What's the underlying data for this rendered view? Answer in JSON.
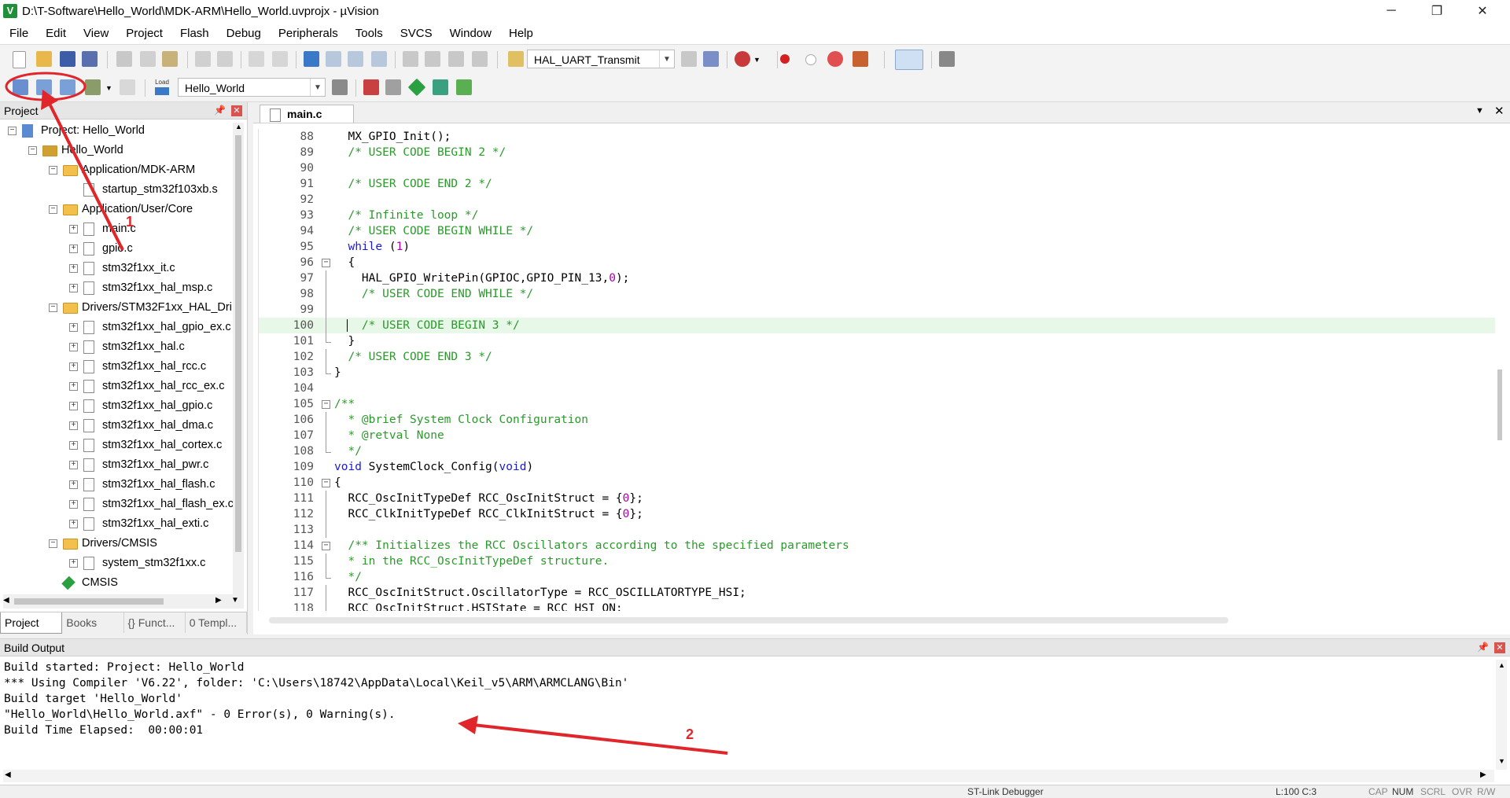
{
  "window": {
    "title": "D:\\T-Software\\Hello_World\\MDK-ARM\\Hello_World.uvprojx - µVision",
    "app_icon_letter": "V"
  },
  "menu": [
    "File",
    "Edit",
    "View",
    "Project",
    "Flash",
    "Debug",
    "Peripherals",
    "Tools",
    "SVCS",
    "Window",
    "Help"
  ],
  "toolbar1": {
    "function_combo": "HAL_UART_Transmit"
  },
  "toolbar2": {
    "load_label": "Load",
    "target_combo": "Hello_World"
  },
  "project_panel": {
    "title": "Project",
    "tree": [
      {
        "label": "Project: Hello_World",
        "level": 0,
        "kind": "root",
        "exp": "−"
      },
      {
        "label": "Hello_World",
        "level": 1,
        "kind": "target",
        "exp": "−"
      },
      {
        "label": "Application/MDK-ARM",
        "level": 2,
        "kind": "folder",
        "exp": "−"
      },
      {
        "label": "startup_stm32f103xb.s",
        "level": 3,
        "kind": "file",
        "exp": ""
      },
      {
        "label": "Application/User/Core",
        "level": 2,
        "kind": "folder",
        "exp": "−"
      },
      {
        "label": "main.c",
        "level": 3,
        "kind": "file",
        "exp": "+"
      },
      {
        "label": "gpio.c",
        "level": 3,
        "kind": "file",
        "exp": "+"
      },
      {
        "label": "stm32f1xx_it.c",
        "level": 3,
        "kind": "file",
        "exp": "+"
      },
      {
        "label": "stm32f1xx_hal_msp.c",
        "level": 3,
        "kind": "file",
        "exp": "+"
      },
      {
        "label": "Drivers/STM32F1xx_HAL_Dri",
        "level": 2,
        "kind": "folder",
        "exp": "−"
      },
      {
        "label": "stm32f1xx_hal_gpio_ex.c",
        "level": 3,
        "kind": "file",
        "exp": "+"
      },
      {
        "label": "stm32f1xx_hal.c",
        "level": 3,
        "kind": "file",
        "exp": "+"
      },
      {
        "label": "stm32f1xx_hal_rcc.c",
        "level": 3,
        "kind": "file",
        "exp": "+"
      },
      {
        "label": "stm32f1xx_hal_rcc_ex.c",
        "level": 3,
        "kind": "file",
        "exp": "+"
      },
      {
        "label": "stm32f1xx_hal_gpio.c",
        "level": 3,
        "kind": "file",
        "exp": "+"
      },
      {
        "label": "stm32f1xx_hal_dma.c",
        "level": 3,
        "kind": "file",
        "exp": "+"
      },
      {
        "label": "stm32f1xx_hal_cortex.c",
        "level": 3,
        "kind": "file",
        "exp": "+"
      },
      {
        "label": "stm32f1xx_hal_pwr.c",
        "level": 3,
        "kind": "file",
        "exp": "+"
      },
      {
        "label": "stm32f1xx_hal_flash.c",
        "level": 3,
        "kind": "file",
        "exp": "+"
      },
      {
        "label": "stm32f1xx_hal_flash_ex.c",
        "level": 3,
        "kind": "file",
        "exp": "+"
      },
      {
        "label": "stm32f1xx_hal_exti.c",
        "level": 3,
        "kind": "file",
        "exp": "+"
      },
      {
        "label": "Drivers/CMSIS",
        "level": 2,
        "kind": "folder",
        "exp": "−"
      },
      {
        "label": "system_stm32f1xx.c",
        "level": 3,
        "kind": "file",
        "exp": "+"
      },
      {
        "label": "CMSIS",
        "level": 2,
        "kind": "component",
        "exp": ""
      }
    ],
    "bottom_tabs": [
      "Project",
      "Books",
      "{} Funct...",
      "0 Templ..."
    ]
  },
  "editor": {
    "tab": "main.c",
    "lines": [
      {
        "n": "88",
        "f": "",
        "segs": [
          [
            "",
            "  MX_GPIO_Init();"
          ]
        ]
      },
      {
        "n": "89",
        "f": "",
        "segs": [
          [
            "cm",
            "  /* USER CODE BEGIN 2 */"
          ]
        ]
      },
      {
        "n": "90",
        "f": "",
        "segs": [
          [
            "",
            ""
          ]
        ]
      },
      {
        "n": "91",
        "f": "",
        "segs": [
          [
            "cm",
            "  /* USER CODE END 2 */"
          ]
        ]
      },
      {
        "n": "92",
        "f": "",
        "segs": [
          [
            "",
            ""
          ]
        ]
      },
      {
        "n": "93",
        "f": "",
        "segs": [
          [
            "cm",
            "  /* Infinite loop */"
          ]
        ]
      },
      {
        "n": "94",
        "f": "",
        "segs": [
          [
            "cm",
            "  /* USER CODE BEGIN WHILE */"
          ]
        ]
      },
      {
        "n": "95",
        "f": "",
        "segs": [
          [
            "kw",
            "  while"
          ],
          [
            "",
            " ("
          ],
          [
            "nu",
            "1"
          ],
          [
            "",
            ")"
          ]
        ]
      },
      {
        "n": "96",
        "f": "box",
        "segs": [
          [
            "",
            "  {"
          ]
        ]
      },
      {
        "n": "97",
        "f": "vl",
        "segs": [
          [
            "",
            "    HAL_GPIO_WritePin(GPIOC,GPIO_PIN_13,"
          ],
          [
            "nu",
            "0"
          ],
          [
            "",
            ");"
          ]
        ]
      },
      {
        "n": "98",
        "f": "vl",
        "segs": [
          [
            "cm",
            "    /* USER CODE END WHILE */"
          ]
        ]
      },
      {
        "n": "99",
        "f": "vl",
        "segs": [
          [
            "",
            ""
          ]
        ]
      },
      {
        "n": "100",
        "f": "vl",
        "cur": true,
        "segs": [
          [
            "cm",
            "    /* USER CODE BEGIN 3 */"
          ]
        ]
      },
      {
        "n": "101",
        "f": "end",
        "segs": [
          [
            "",
            "  }"
          ]
        ]
      },
      {
        "n": "102",
        "f": "vl",
        "segs": [
          [
            "cm",
            "  /* USER CODE END 3 */"
          ]
        ]
      },
      {
        "n": "103",
        "f": "end",
        "segs": [
          [
            "",
            "}"
          ]
        ]
      },
      {
        "n": "104",
        "f": "",
        "segs": [
          [
            "",
            ""
          ]
        ]
      },
      {
        "n": "105",
        "f": "box",
        "segs": [
          [
            "cm",
            "/**"
          ]
        ]
      },
      {
        "n": "106",
        "f": "vl",
        "segs": [
          [
            "cm",
            "  * @brief System Clock Configuration"
          ]
        ]
      },
      {
        "n": "107",
        "f": "vl",
        "segs": [
          [
            "cm",
            "  * @retval None"
          ]
        ]
      },
      {
        "n": "108",
        "f": "end",
        "segs": [
          [
            "cm",
            "  */"
          ]
        ]
      },
      {
        "n": "109",
        "f": "",
        "segs": [
          [
            "kw",
            "void"
          ],
          [
            "",
            " SystemClock_Config("
          ],
          [
            "kw",
            "void"
          ],
          [
            "",
            ")"
          ]
        ]
      },
      {
        "n": "110",
        "f": "box",
        "segs": [
          [
            "",
            "{"
          ]
        ]
      },
      {
        "n": "111",
        "f": "vl",
        "segs": [
          [
            "",
            "  RCC_OscInitTypeDef RCC_OscInitStruct = {"
          ],
          [
            "nu",
            "0"
          ],
          [
            "",
            "};"
          ]
        ]
      },
      {
        "n": "112",
        "f": "vl",
        "segs": [
          [
            "",
            "  RCC_ClkInitTypeDef RCC_ClkInitStruct = {"
          ],
          [
            "nu",
            "0"
          ],
          [
            "",
            "};"
          ]
        ]
      },
      {
        "n": "113",
        "f": "vl",
        "segs": [
          [
            "",
            ""
          ]
        ]
      },
      {
        "n": "114",
        "f": "box",
        "segs": [
          [
            "cm",
            "  /** Initializes the RCC Oscillators according to the specified parameters"
          ]
        ]
      },
      {
        "n": "115",
        "f": "vl",
        "segs": [
          [
            "cm",
            "  * in the RCC_OscInitTypeDef structure."
          ]
        ]
      },
      {
        "n": "116",
        "f": "end",
        "segs": [
          [
            "cm",
            "  */"
          ]
        ]
      },
      {
        "n": "117",
        "f": "vl",
        "segs": [
          [
            "",
            "  RCC_OscInitStruct.OscillatorType = RCC_OSCILLATORTYPE_HSI;"
          ]
        ]
      },
      {
        "n": "118",
        "f": "vl",
        "segs": [
          [
            "",
            "  RCC_OscInitStruct.HSIState = RCC_HSI_ON;"
          ]
        ]
      }
    ]
  },
  "build_output": {
    "title": "Build Output",
    "lines": [
      "Build started: Project: Hello_World",
      "*** Using Compiler 'V6.22', folder: 'C:\\Users\\18742\\AppData\\Local\\Keil_v5\\ARM\\ARMCLANG\\Bin'",
      "Build target 'Hello_World'",
      "\"Hello_World\\Hello_World.axf\" - 0 Error(s), 0 Warning(s).",
      "Build Time Elapsed:  00:00:01"
    ]
  },
  "status": {
    "debugger": "ST-Link Debugger",
    "position": "L:100 C:3",
    "caps": "CAP",
    "num": "NUM",
    "scrl": "SCRL",
    "ovr": "OVR",
    "rw": "R/W"
  },
  "annotations": {
    "label_1": "1",
    "label_2": "2",
    "color": "#e0262b"
  }
}
